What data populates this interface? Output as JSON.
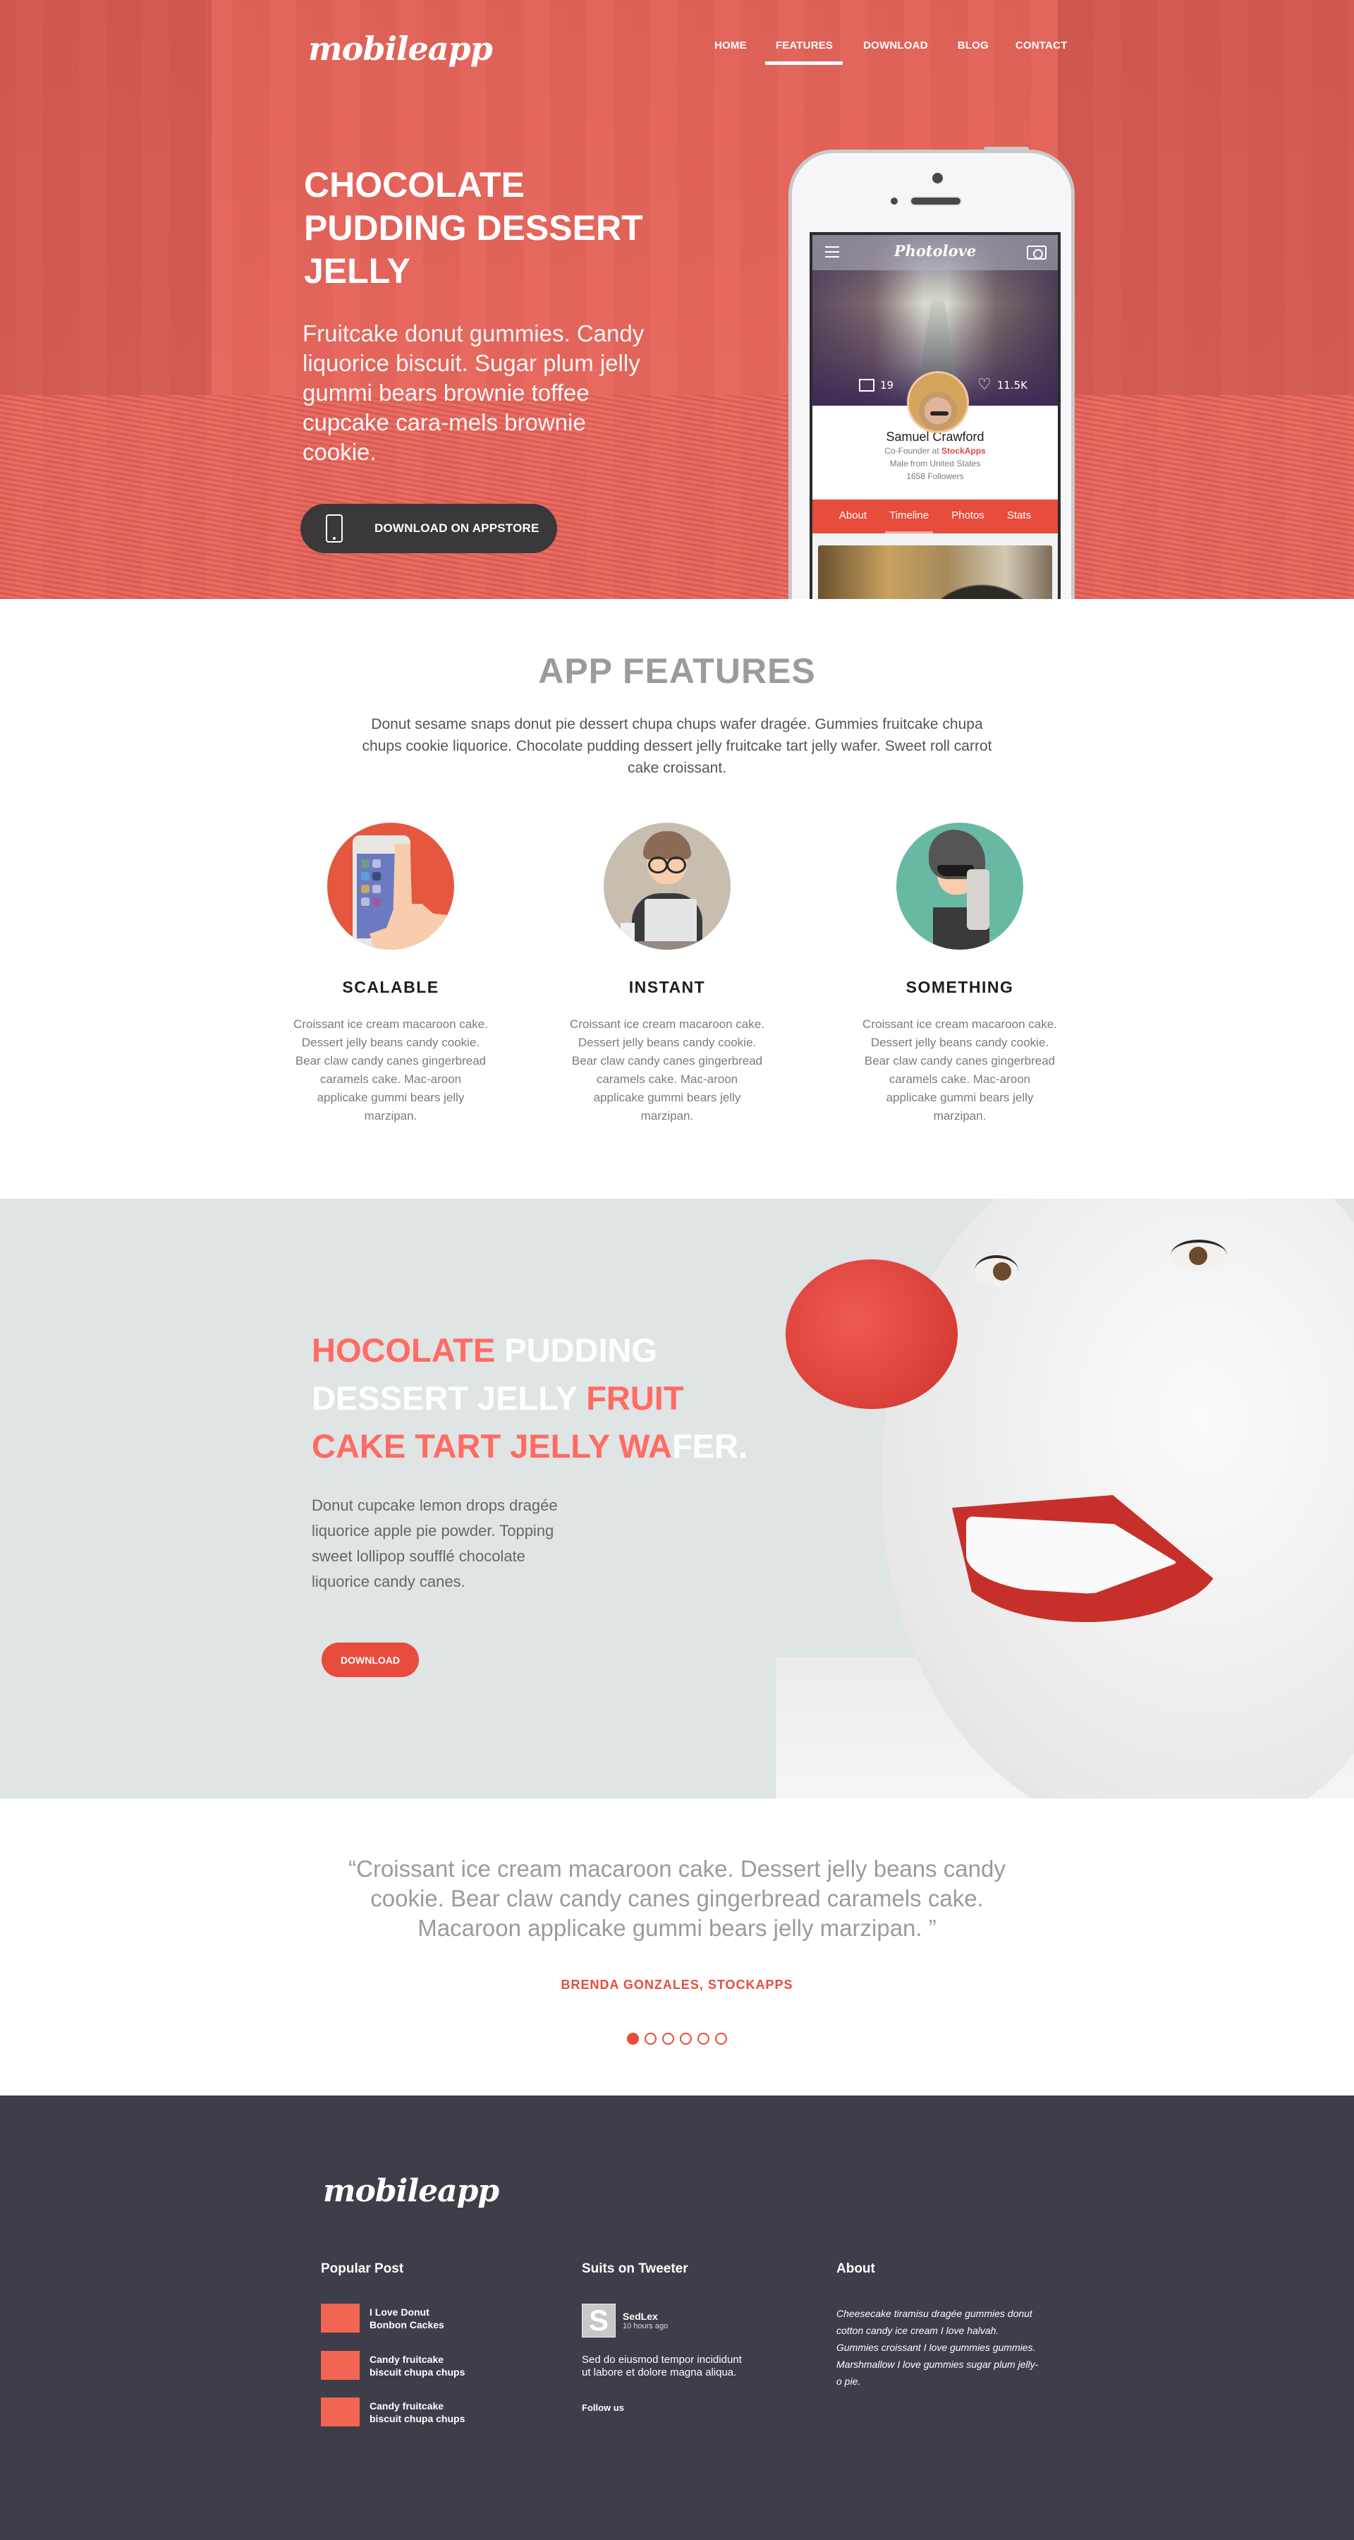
{
  "brand": {
    "logo": "mobileapp",
    "accent_color": "#e74c3c"
  },
  "nav": {
    "items": [
      {
        "label": "HOME",
        "active": false
      },
      {
        "label": "FEATURES",
        "active": true
      },
      {
        "label": "DOWNLOAD",
        "active": false
      },
      {
        "label": "BLOG",
        "active": false
      },
      {
        "label": "CONTACT",
        "active": false
      }
    ]
  },
  "hero": {
    "title": "CHOCOLATE PUDDING DESSERT JELLY",
    "text": "Fruitcake donut gummies. Candy liquorice biscuit. Sugar plum jelly gummi bears brownie toffee cupcake cara-mels brownie cookie.",
    "cta_label": "DOWNLOAD ON APPSTORE",
    "cta_icon": "smartphone-icon"
  },
  "phone_app": {
    "app_title": "Photolove",
    "menu_icon": "hamburger-menu-icon",
    "camera_icon": "camera-icon",
    "photos_count": "19",
    "likes_count": "11.5K",
    "profile_name": "Samuel Crawford",
    "role_prefix": "Co-Founder at ",
    "company": "StockApps",
    "location": "Male from United States",
    "followers": "1658 Followers",
    "tabs": [
      {
        "label": "About",
        "active": false
      },
      {
        "label": "Timeline",
        "active": true
      },
      {
        "label": "Photos",
        "active": false
      },
      {
        "label": "Stats",
        "active": false
      }
    ]
  },
  "features": {
    "title": "APP FEATURES",
    "description": "Donut sesame snaps donut pie dessert chupa chups wafer dragée. Gummies fruitcake chupa chups cookie liquorice. Chocolate pudding dessert jelly fruitcake tart jelly wafer. Sweet roll carrot cake croissant.",
    "items": [
      {
        "title": "SCALABLE",
        "icon": "touch-phone-illustration",
        "color": "#e5573f",
        "text": "Croissant ice cream macaroon cake. Dessert jelly beans candy cookie. Bear claw candy canes gingerbread caramels cake. Mac-aroon applicake gummi bears jelly marzipan."
      },
      {
        "title": "INSTANT",
        "icon": "developer-laptop-illustration",
        "color": "#c8beb0",
        "text": "Croissant ice cream macaroon cake. Dessert jelly beans candy cookie. Bear claw candy canes gingerbread caramels cake. Mac-aroon applicake gummi bears jelly marzipan."
      },
      {
        "title": "SOMETHING",
        "icon": "selfie-guy-illustration",
        "color": "#68b9a4",
        "text": "Croissant ice cream macaroon cake. Dessert jelly beans candy cookie. Bear claw candy canes gingerbread caramels cake. Mac-aroon applicake gummi bears jelly marzipan."
      }
    ]
  },
  "promo": {
    "title_parts": [
      {
        "text": "HOCOLATE ",
        "color": "red"
      },
      {
        "text": "PUDDING",
        "color": "white"
      },
      {
        "text": "DESSERT JELLY ",
        "color": "white"
      },
      {
        "text": "FRUIT",
        "color": "red"
      },
      {
        "text": "CAKE TART JELLY WA",
        "color": "red"
      },
      {
        "text": "FER.",
        "color": "white"
      }
    ],
    "text": "Donut cupcake lemon drops dragée liquorice apple pie powder. Topping sweet lollipop soufflé chocolate liquorice candy canes.",
    "button_label": "DOWNLOAD",
    "image": "clown-face-photo"
  },
  "testimonial": {
    "quote": "“Croissant ice cream macaroon cake. Dessert jelly beans candy cookie. Bear claw candy canes gingerbread caramels cake. Macaroon applicake gummi bears jelly marzipan. ”",
    "author": "BRENDA GONZALES, STOCKAPPS",
    "slides_total": 6,
    "active_slide": 1
  },
  "footer": {
    "logo": "mobileapp",
    "popular": {
      "title": "Popular Post",
      "posts": [
        {
          "line1": "I Love Donut",
          "line2": "Bonbon Cackes"
        },
        {
          "line1": "Candy fruitcake",
          "line2": "biscuit chupa chups"
        },
        {
          "line1": "Candy fruitcake",
          "line2": "biscuit chupa chups"
        }
      ]
    },
    "tweets": {
      "title": "Suits on Tweeter",
      "avatar_letter": "S",
      "user": "SedLex",
      "time": "10 hours ago",
      "text": "Sed do eiusmod tempor incididunt ut labore et dolore magna aliqua.",
      "follow_label": "Follow us"
    },
    "about": {
      "title": "About",
      "text": "Cheesecake tiramisu dragée gummies donut cotton candy ice cream I love halvah. Gummies croissant I love gummies gummies. Marshmallow I love gummies sugar plum jelly-o pie."
    }
  }
}
